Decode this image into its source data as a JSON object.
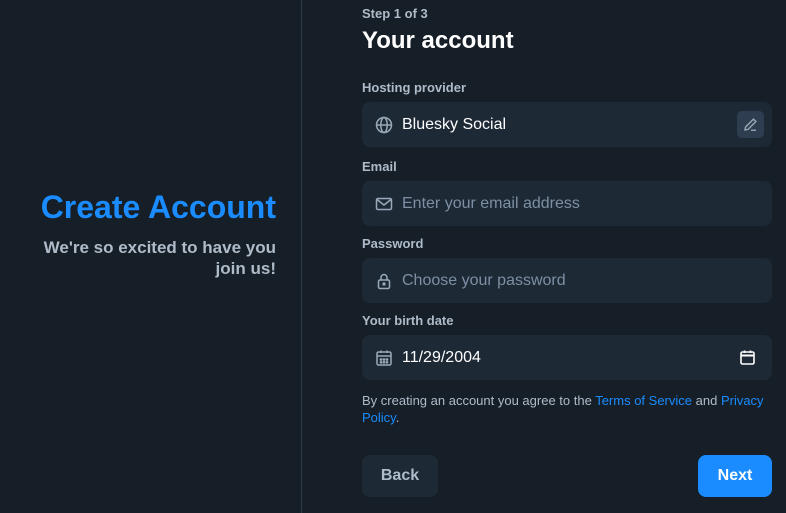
{
  "hero": {
    "title": "Create Account",
    "subtitle": "We're so excited to have you join us!"
  },
  "form": {
    "step": "Step 1 of 3",
    "title": "Your account",
    "provider": {
      "label": "Hosting provider",
      "value": "Bluesky Social",
      "icon": "globe-icon"
    },
    "email": {
      "label": "Email",
      "placeholder": "Enter your email address",
      "icon": "envelope-icon"
    },
    "password": {
      "label": "Password",
      "placeholder": "Choose your password",
      "icon": "lock-icon"
    },
    "birthdate": {
      "label": "Your birth date",
      "value": "11/29/2004",
      "icon": "calendar-icon"
    },
    "terms": {
      "prefix": "By creating an account you agree to the ",
      "tos": "Terms of Service",
      "middle": " and ",
      "privacy": "Privacy Policy",
      "suffix": "."
    },
    "back_label": "Back",
    "next_label": "Next"
  },
  "colors": {
    "background": "#161e27",
    "accent": "#1a8cff",
    "field": "#1e2936",
    "muted_text": "#aebbc9"
  }
}
